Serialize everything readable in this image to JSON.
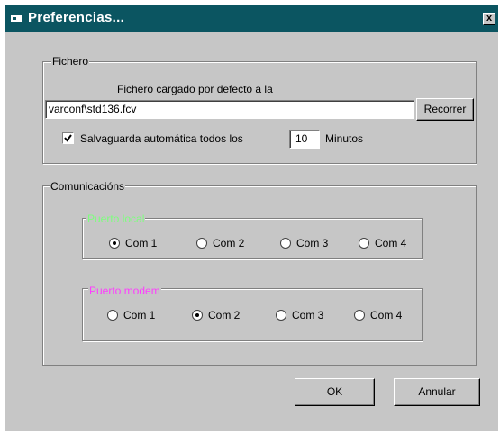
{
  "window": {
    "title": "Preferencias...",
    "close_glyph": "x",
    "accent": "#0b5561"
  },
  "fichero": {
    "legend": "Fichero",
    "default_label": "Fichero cargado por defecto a la",
    "path_value": "varconf\\std136.fcv",
    "browse_label": "Recorrer",
    "autosave_checked": true,
    "autosave_label": "Salvaguarda automática todos los",
    "minutes_value": "10",
    "minutes_label": "Minutos"
  },
  "comunicaciones": {
    "legend": "Comunicacións",
    "puerto_local": {
      "legend": "Puerto local",
      "legend_color": "#7dff7d",
      "options": [
        "Com 1",
        "Com 2",
        "Com 3",
        "Com 4"
      ],
      "selected": 0
    },
    "puerto_modem": {
      "legend": "Puerto modem",
      "legend_color": "#ff3cff",
      "options": [
        "Com 1",
        "Com 2",
        "Com 3",
        "Com 4"
      ],
      "selected": 1
    }
  },
  "buttons": {
    "ok": "OK",
    "cancel": "Annular"
  }
}
